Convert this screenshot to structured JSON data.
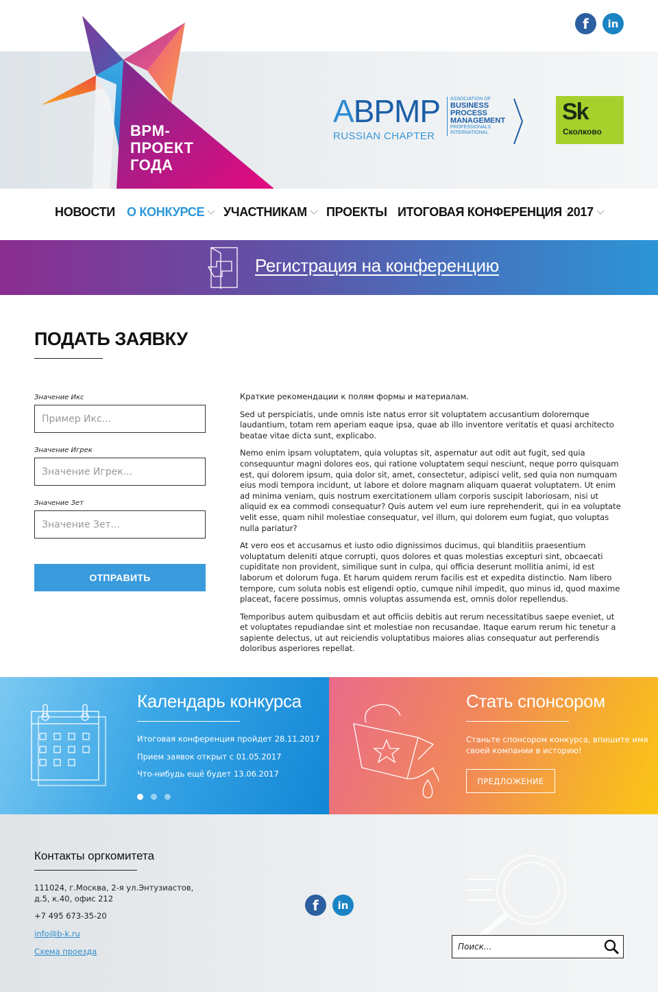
{
  "social": {
    "facebook_glyph": "f",
    "linkedin_glyph": "in"
  },
  "logo": {
    "line1": "BPM-",
    "line2": "ПРОЕКТ",
    "line3": "ГОДА"
  },
  "abpmp": {
    "mark_a": "A",
    "mark_rest": "BPMP",
    "sub": "RUSSIAN CHAPTER",
    "assoc": "ASSOCIATION OF",
    "b1": "BUSINESS",
    "b2": "PROCESS",
    "b3": "MANAGEMENT",
    "p1": "PROFESSIONALS",
    "p2": "INTERNATIONAL"
  },
  "skolkovo": {
    "mark": "Sk",
    "name": "Сколково"
  },
  "nav": {
    "items": [
      {
        "label": "НОВОСТИ"
      },
      {
        "label": "О КОНКУРСЕ"
      },
      {
        "label": "УЧАСТНИКАМ"
      },
      {
        "label": "ПРОЕКТЫ"
      },
      {
        "label": "ИТОГОВАЯ КОНФЕРЕНЦИЯ"
      },
      {
        "label": "2017"
      }
    ]
  },
  "banner": {
    "label": "Регистрация на конференцию"
  },
  "form": {
    "title": "ПОДАТЬ ЗАЯВКУ",
    "fields": [
      {
        "label": "Значение Икс",
        "placeholder": "Пример Икс..."
      },
      {
        "label": "Значение Игрек",
        "placeholder": "Значение Игрек..."
      },
      {
        "label": "Значение Зет",
        "placeholder": "Значение Зет..."
      }
    ],
    "submit": "ОТПРАВИТЬ"
  },
  "text": {
    "p0": "Краткие рекомендации к полям формы и материалам.",
    "p1": "Sed ut perspiciatis, unde omnis iste natus error sit voluptatem accusantium doloremque laudantium, totam rem aperiam eaque ipsa, quae ab illo inventore veritatis et quasi architecto beatae vitae dicta sunt, explicabo.",
    "p2": "Nemo enim ipsam voluptatem, quia voluptas sit, aspernatur aut odit aut fugit, sed quia consequuntur magni dolores eos, qui ratione voluptatem sequi nesciunt, neque porro quisquam est, qui dolorem ipsum, quia dolor sit, amet, consectetur, adipisci velit, sed quia non numquam eius modi tempora incidunt, ut labore et dolore magnam aliquam quaerat voluptatem. Ut enim ad minima veniam, quis nostrum exercitationem ullam corporis suscipit laboriosam, nisi ut aliquid ex ea commodi consequatur? Quis autem vel eum iure reprehenderit, qui in ea voluptate velit esse, quam nihil molestiae consequatur, vel illum, qui dolorem eum fugiat, quo voluptas nulla pariatur?",
    "p3": "At vero eos et accusamus et iusto odio dignissimos ducimus, qui blanditiis praesentium voluptatum deleniti atque corrupti, quos dolores et quas molestias excepturi sint, obcaecati cupiditate non provident, similique sunt in culpa, qui officia deserunt mollitia animi, id est laborum et dolorum fuga. Et harum quidem rerum facilis est et expedita distinctio. Nam libero tempore, cum soluta nobis est eligendi optio, cumque nihil impedit, quo minus id, quod maxime placeat, facere possimus, omnis voluptas assumenda est, omnis dolor repellendus.",
    "p4": "Temporibus autem quibusdam et aut officiis debitis aut rerum necessitatibus saepe eveniet, ut et voluptates repudiandae sint et molestiae non recusandae. Itaque earum rerum hic tenetur a sapiente delectus, ut aut reiciendis voluptatibus maiores alias consequatur aut perferendis doloribus asperiores repellat."
  },
  "calendar": {
    "title": "Календарь конкурса",
    "events": [
      "Итоговая конференция пройдет 28.11.2017",
      "Прием заявок открыт с 01.05.2017",
      "Что-нибудь ещё будет 13.06.2017"
    ],
    "dots_active": 0
  },
  "sponsor": {
    "title": "Стать спонсором",
    "text1": "Станьте спонсором конкурса, впишите имя",
    "text2": "своей компании в историю!",
    "button": "ПРЕДЛОЖЕНИЕ"
  },
  "footer": {
    "title": "Контакты оргкомитета",
    "address1": "111024, г.Москва, 2-я ул.Энтузиастов,",
    "address2": "д.5, к.40, офис 212",
    "phone": "+7 495 673-35-20",
    "email": "info@b-k.ru",
    "map_link": "Схема проезда",
    "search_placeholder": "Поиск..."
  },
  "colors": {
    "accent": "#2b97d8",
    "button": "#3a9bdc",
    "sk_green": "#a6d12c"
  }
}
